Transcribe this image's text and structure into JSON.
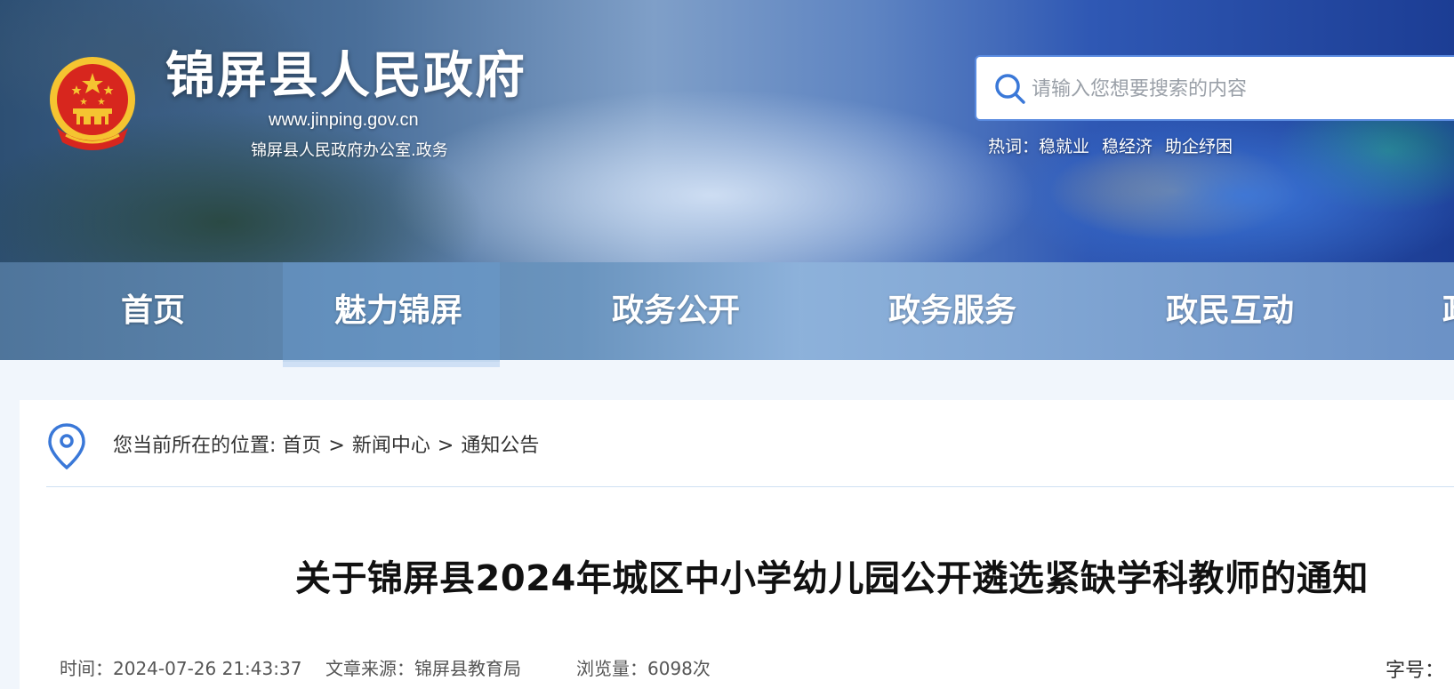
{
  "header": {
    "site_title": "锦屏县人民政府",
    "site_url": "www.jinping.gov.cn",
    "site_subtitle": "锦屏县人民政府办公室.政务",
    "search": {
      "placeholder": "请输入您想要搜索的内容",
      "value": ""
    },
    "hot_words": {
      "label": "热词：",
      "items": [
        "稳就业",
        "稳经济",
        "助企纾困"
      ]
    }
  },
  "nav": {
    "items": [
      {
        "label": "首页"
      },
      {
        "label": "魅力锦屏"
      },
      {
        "label": "政务公开"
      },
      {
        "label": "政务服务"
      },
      {
        "label": "政民互动"
      },
      {
        "label": "政"
      }
    ],
    "active": "魅力锦屏"
  },
  "breadcrumb": {
    "prefix": "您当前所在的位置: ",
    "items": [
      "首页",
      "新闻中心",
      "通知公告"
    ],
    "separator": ">"
  },
  "article": {
    "title": "关于锦屏县2024年城区中小学幼儿园公开遴选紧缺学科教师的通知",
    "time_label": "时间：",
    "time": "2024-07-26 21:43:37",
    "source_label": "文章来源：",
    "source": "锦屏县教育局",
    "views_label": "浏览量：",
    "views": "6098次",
    "font_size_label": "字号："
  },
  "colors": {
    "search_border": "#5a8be0",
    "search_icon": "#3a78d8",
    "emblem_red": "#d7261e",
    "emblem_gold": "#f5c431",
    "location_icon": "#3a78d8",
    "divider": "#cfe0f2"
  }
}
